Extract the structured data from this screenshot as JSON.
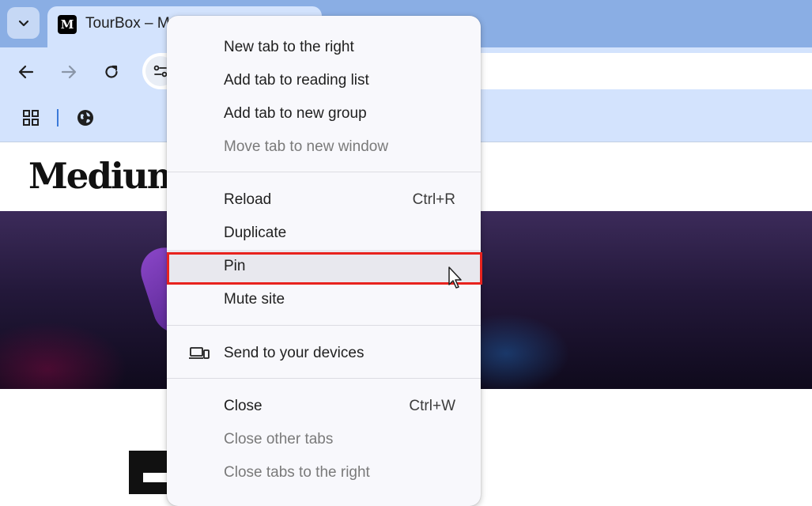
{
  "tab": {
    "title": "TourBox – M",
    "favicon_text": "M"
  },
  "page": {
    "logo_text": "Medium"
  },
  "context_menu": {
    "items": [
      {
        "label": "New tab to the right",
        "shortcut": "",
        "enabled": true
      },
      {
        "label": "Add tab to reading list",
        "shortcut": "",
        "enabled": true
      },
      {
        "label": "Add tab to new group",
        "shortcut": "",
        "enabled": true
      },
      {
        "label": "Move tab to new window",
        "shortcut": "",
        "enabled": false
      },
      {
        "label": "Reload",
        "shortcut": "Ctrl+R",
        "enabled": true
      },
      {
        "label": "Duplicate",
        "shortcut": "",
        "enabled": true
      },
      {
        "label": "Pin",
        "shortcut": "",
        "enabled": true,
        "hovered": true,
        "highlighted": true
      },
      {
        "label": "Mute site",
        "shortcut": "",
        "enabled": true
      },
      {
        "label": "Send to your devices",
        "shortcut": "",
        "enabled": true,
        "icon": "devices-icon"
      },
      {
        "label": "Close",
        "shortcut": "Ctrl+W",
        "enabled": true
      },
      {
        "label": "Close other tabs",
        "shortcut": "",
        "enabled": false
      },
      {
        "label": "Close tabs to the right",
        "shortcut": "",
        "enabled": false
      }
    ]
  },
  "colors": {
    "tabstrip": "#8aaee4",
    "toolbar": "#d3e3fd",
    "menu_background": "#f8f8fc",
    "highlight_border": "#e8231e"
  }
}
